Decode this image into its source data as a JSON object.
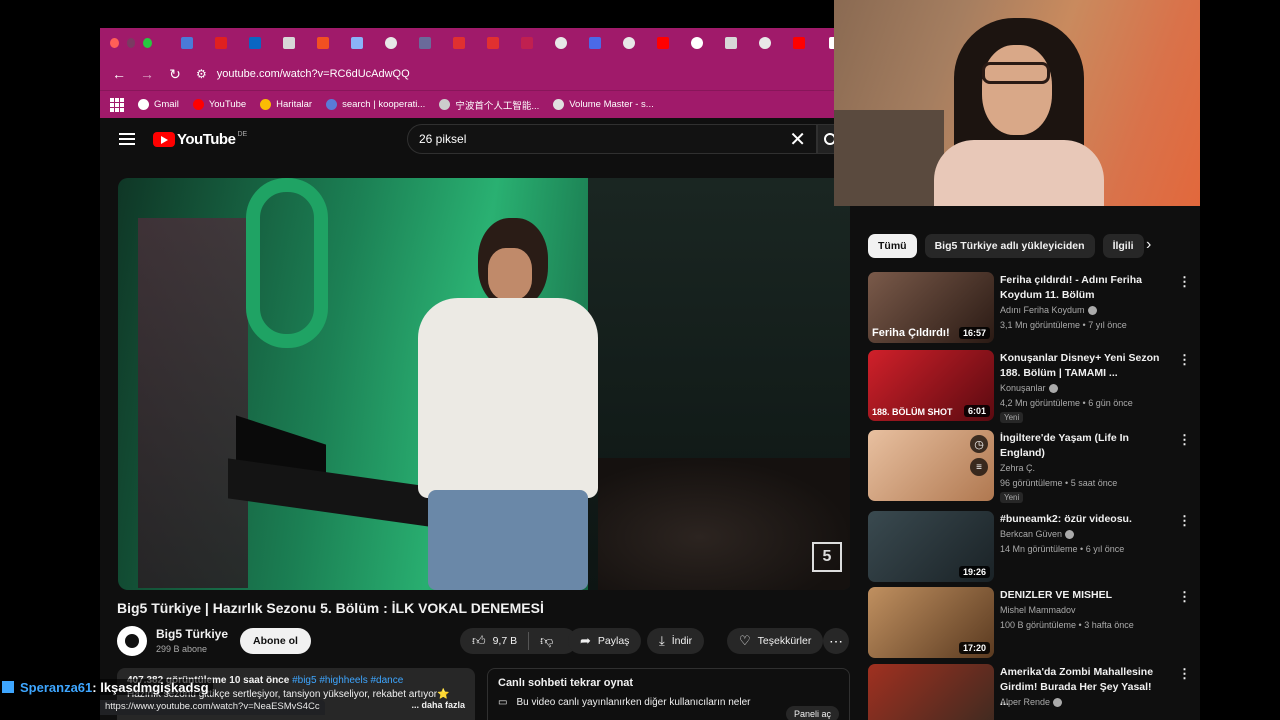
{
  "browser": {
    "url": "youtube.com/watch?v=RC6dUcAdwQQ",
    "status_url": "https://www.youtube.com/watch?v=NeaESMvS4Cc",
    "bookmarks": [
      {
        "label": "Gmail",
        "color": "#ffffff"
      },
      {
        "label": "YouTube",
        "color": "#ff0000"
      },
      {
        "label": "Haritalar",
        "color": "#fbbc04"
      },
      {
        "label": "search | kooperati...",
        "color": "#5a7bd8"
      },
      {
        "label": "宁波首个人工智能...",
        "color": "#cccccc"
      },
      {
        "label": "Volume Master - s...",
        "color": "#e0e0e0"
      }
    ],
    "colors": {
      "chrome": "#a01a6a"
    }
  },
  "youtube": {
    "logo_text": "YouTube",
    "country_code": "DE",
    "search_query": "26 piksel"
  },
  "video": {
    "title": "Big5 Türkiye | Hazırlık Sezonu 5. Bölüm : İLK VOKAL DENEMESİ",
    "channel": "Big5 Türkiye",
    "subscribers": "299 B abone",
    "subscribe_label": "Abone ol",
    "likes": "9,7 B",
    "share_label": "Paylaş",
    "download_label": "İndir",
    "thanks_label": "Teşekkürler",
    "overlay_logo": "5",
    "description": {
      "meta": "407.382 görüntüleme  10 saat önce",
      "tags": "#big5 #highheels #dance",
      "line2": "Hazırlık sezonu gittikçe sertleşiyor, tansiyon yükseliyor, rekabet artıyor⭐",
      "more": "... daha fazla"
    },
    "chat": {
      "title": "Canlı sohbeti tekrar oynat",
      "subtitle": "Bu video canlı yayınlanırken diğer kullanıcıların neler",
      "button": "Paneli aç"
    }
  },
  "sidebar": {
    "chips": [
      "Tümü",
      "Big5 Türkiye adlı yükleyiciden",
      "İlgili"
    ],
    "recommendations": [
      {
        "title": "Feriha çıldırdı! - Adını Feriha Koydum 11. Bölüm",
        "channel": "Adını Feriha Koydum",
        "views": "3,1 Mn görüntüleme • 7 yıl önce",
        "duration": "16:57",
        "badge": "",
        "thumb_colors": [
          "#7a5a4a",
          "#2a1a14"
        ],
        "thumb_text": "Feriha Çıldırdı!"
      },
      {
        "title": "Konuşanlar Disney+ Yeni Sezon 188. Bölüm | TAMAMI ...",
        "channel": "Konuşanlar",
        "views": "4,2 Mn görüntüleme • 6 gün önce",
        "duration": "6:01",
        "badge": "Yeni",
        "thumb_colors": [
          "#d0202a",
          "#5a0a10"
        ],
        "thumb_text": "188. BÖLÜM SHOT"
      },
      {
        "title": "İngiltere'de Yaşam (Life In England)",
        "channel": "Zehra Ç.",
        "views": "96 görüntüleme • 5 saat önce",
        "duration": "",
        "badge": "Yeni",
        "thumb_colors": [
          "#e8c0a0",
          "#b07850"
        ],
        "thumb_text": ""
      },
      {
        "title": "#buneamk2: özür videosu.",
        "channel": "Berkcan Güven",
        "views": "14 Mn görüntüleme • 6 yıl önce",
        "duration": "19:26",
        "badge": "",
        "thumb_colors": [
          "#3a4a50",
          "#1a2226"
        ],
        "thumb_text": ""
      },
      {
        "title": "DENIZLER VE MISHEL",
        "channel": "Mishel Mammadov",
        "views": "100 B görüntüleme • 3 hafta önce",
        "duration": "17:20",
        "badge": "",
        "thumb_colors": [
          "#c09060",
          "#5a3a20"
        ],
        "thumb_text": ""
      },
      {
        "title": "Amerika'da Zombi Mahallesine Girdim! Burada Her Şey Yasal! ...",
        "channel": "Alper Rende",
        "views": "",
        "duration": "",
        "badge": "",
        "thumb_colors": [
          "#a03020",
          "#3a2a20"
        ],
        "thumb_text": ""
      }
    ]
  },
  "overlay": {
    "chat_user": "Speranza61",
    "chat_message": " : lkşasdmgişkadsg"
  }
}
